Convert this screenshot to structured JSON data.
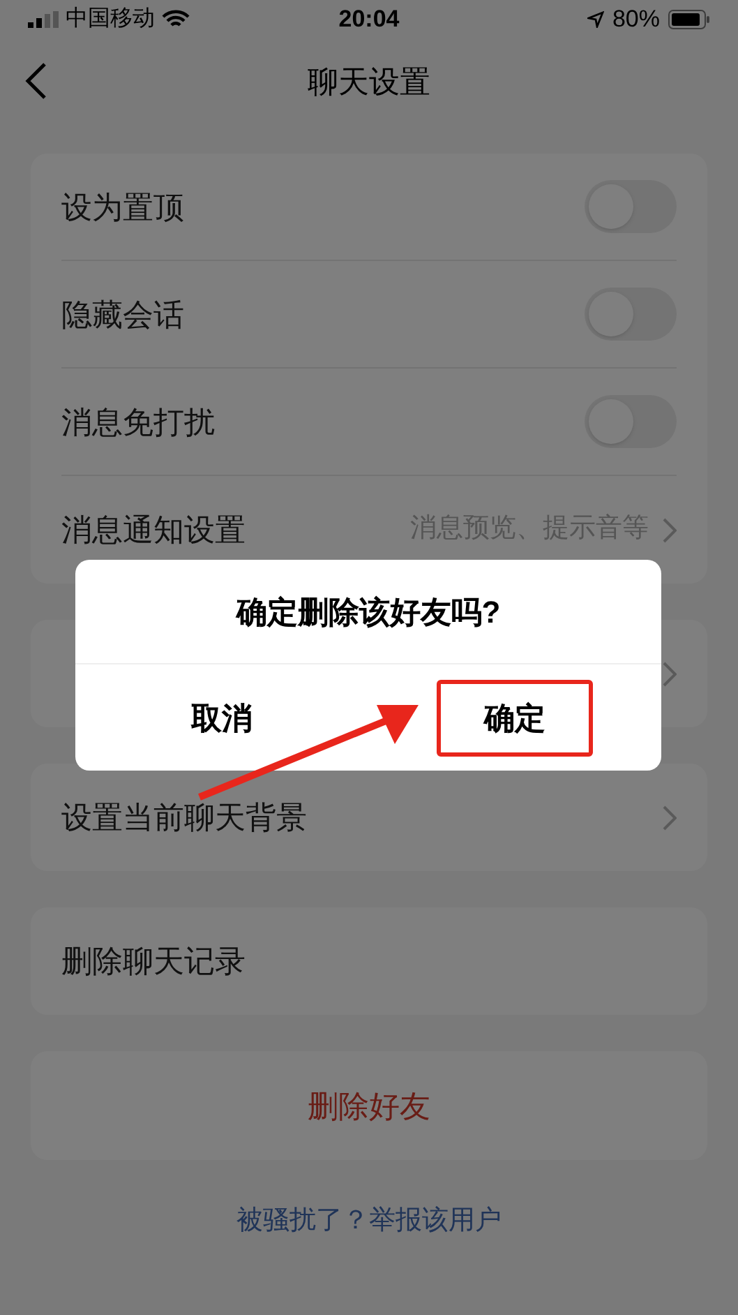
{
  "status_bar": {
    "carrier": "中国移动",
    "time": "20:04",
    "battery": "80%"
  },
  "nav": {
    "title": "聊天设置"
  },
  "groups": [
    {
      "rows": [
        {
          "kind": "toggle",
          "label": "设为置顶",
          "on": false
        },
        {
          "kind": "toggle",
          "label": "隐藏会话",
          "on": false
        },
        {
          "kind": "toggle",
          "label": "消息免打扰",
          "on": false
        },
        {
          "kind": "link",
          "label": "消息通知设置",
          "detail": "消息预览、提示音等"
        }
      ]
    },
    {
      "rows": [
        {
          "kind": "link"
        }
      ]
    },
    {
      "rows": [
        {
          "kind": "link",
          "label": "设置当前聊天背景"
        }
      ]
    },
    {
      "rows": [
        {
          "kind": "plain",
          "label": "删除聊天记录"
        }
      ]
    },
    {
      "rows": [
        {
          "kind": "danger",
          "label": "删除好友"
        }
      ]
    }
  ],
  "report_link": "被骚扰了？举报该用户",
  "dialog": {
    "title": "确定删除该好友吗?",
    "buttons": [
      {
        "label": "取消",
        "highlighted": false
      },
      {
        "label": "确定",
        "highlighted": true
      }
    ]
  }
}
